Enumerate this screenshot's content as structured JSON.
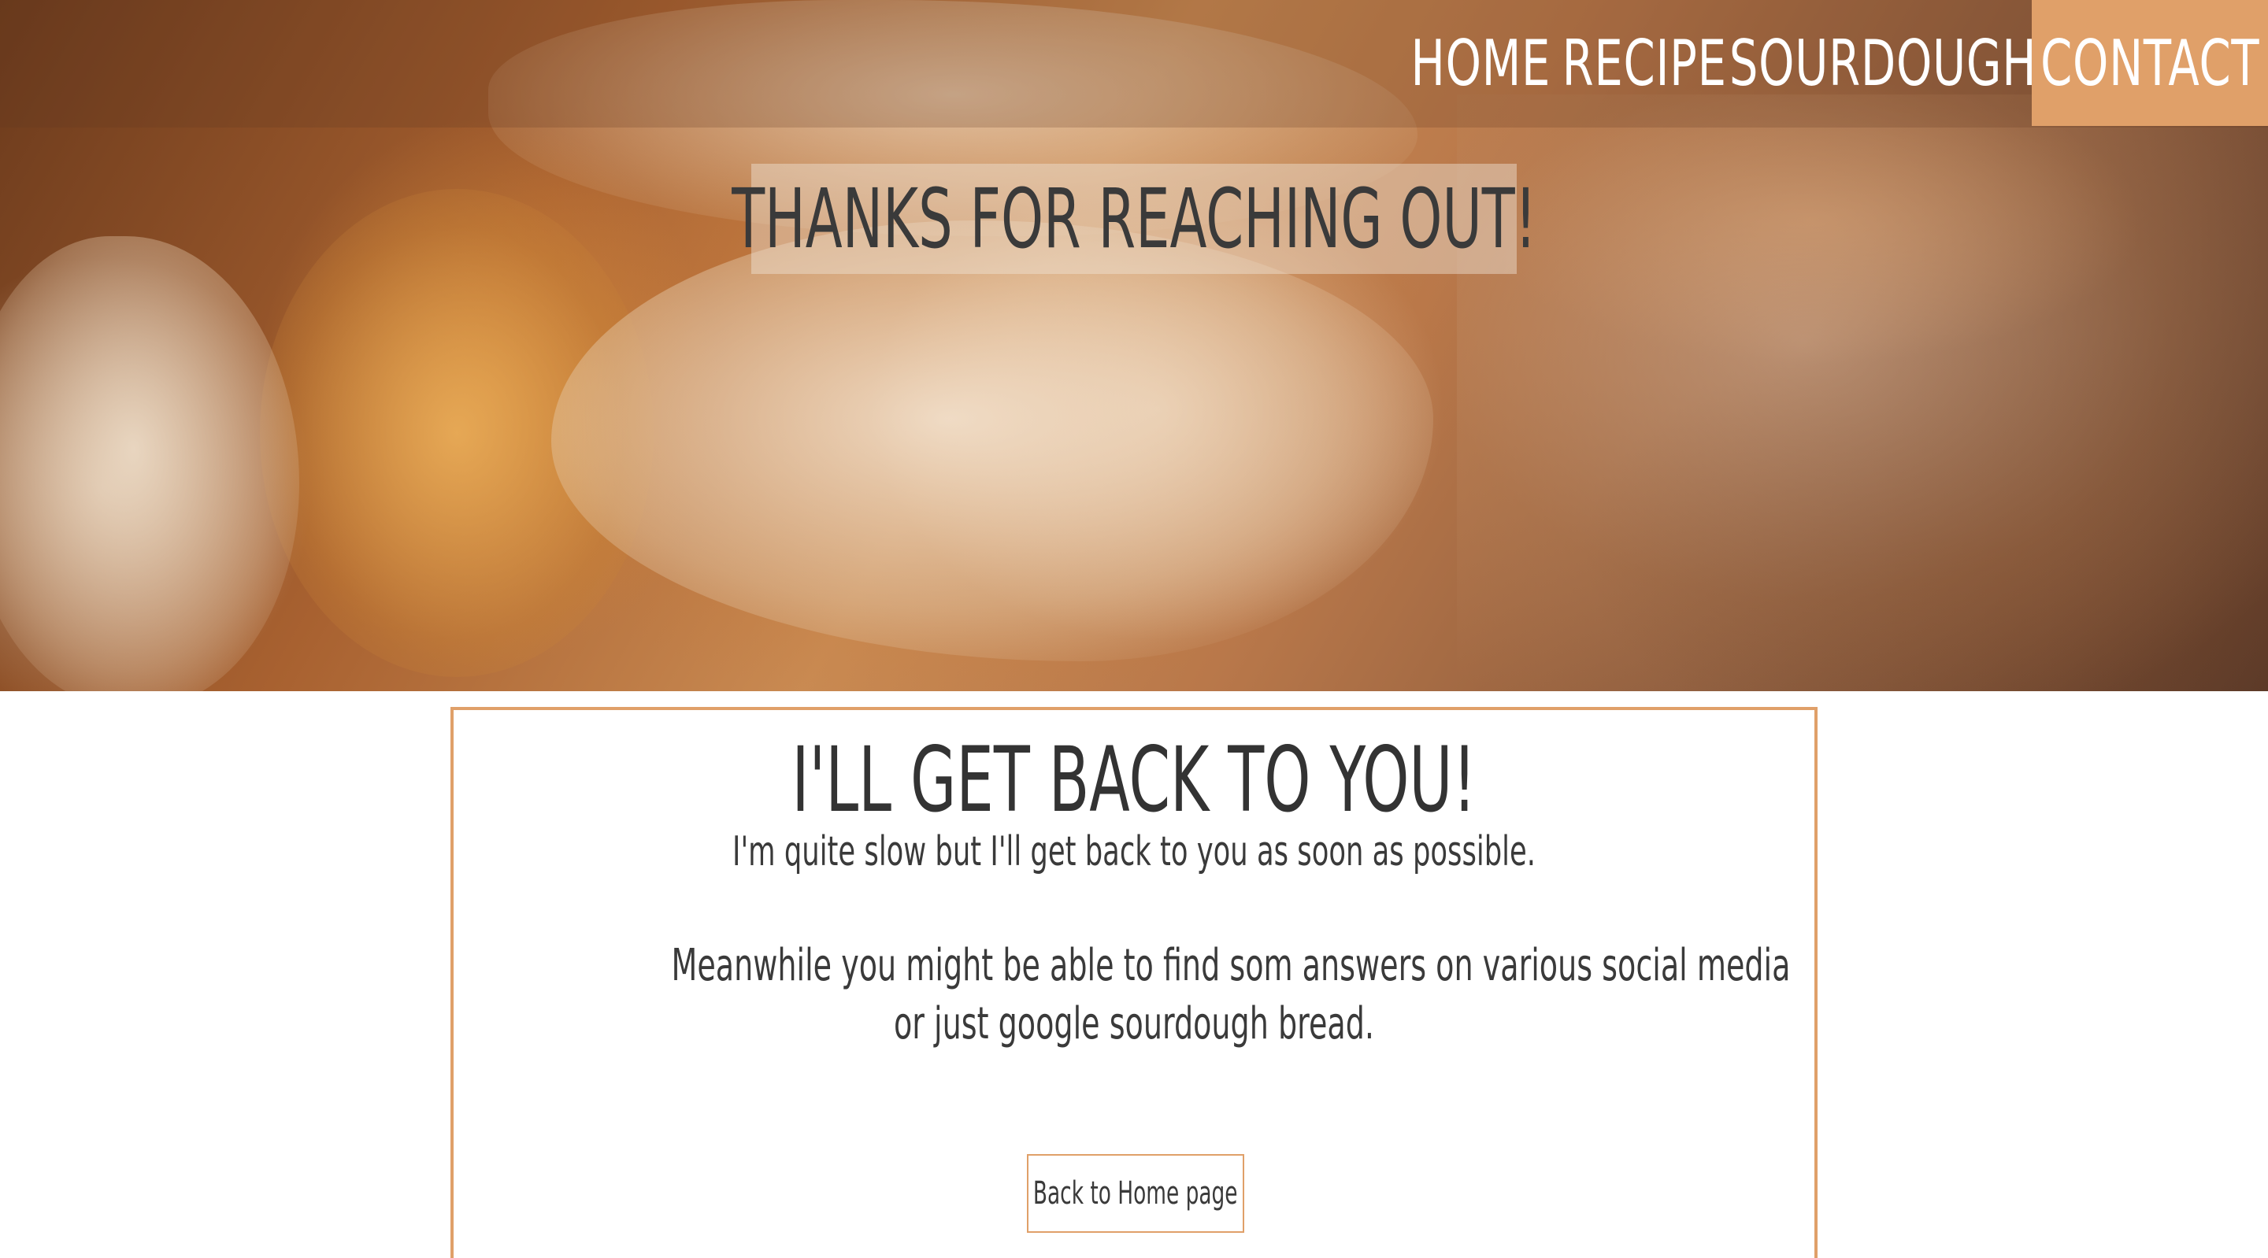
{
  "nav": {
    "items": [
      {
        "label": "HOME"
      },
      {
        "label": "RECIPE"
      },
      {
        "label": "SOURDOUGH"
      },
      {
        "label": "CONTACT",
        "active": true
      }
    ]
  },
  "hero": {
    "title": "THANKS FOR REACHING OUT!"
  },
  "card": {
    "title": "I'LL GET BACK TO YOU!",
    "line1": "I'm quite slow but I'll get back to you as soon as possible.",
    "line2": "Meanwhile you might be able to find som answers on various social media",
    "line3": "or just google sourdough bread.",
    "button_label": "Back to Home page"
  },
  "colors": {
    "accent": "#e0a069",
    "text": "#333333",
    "nav_text": "#ffffff"
  }
}
